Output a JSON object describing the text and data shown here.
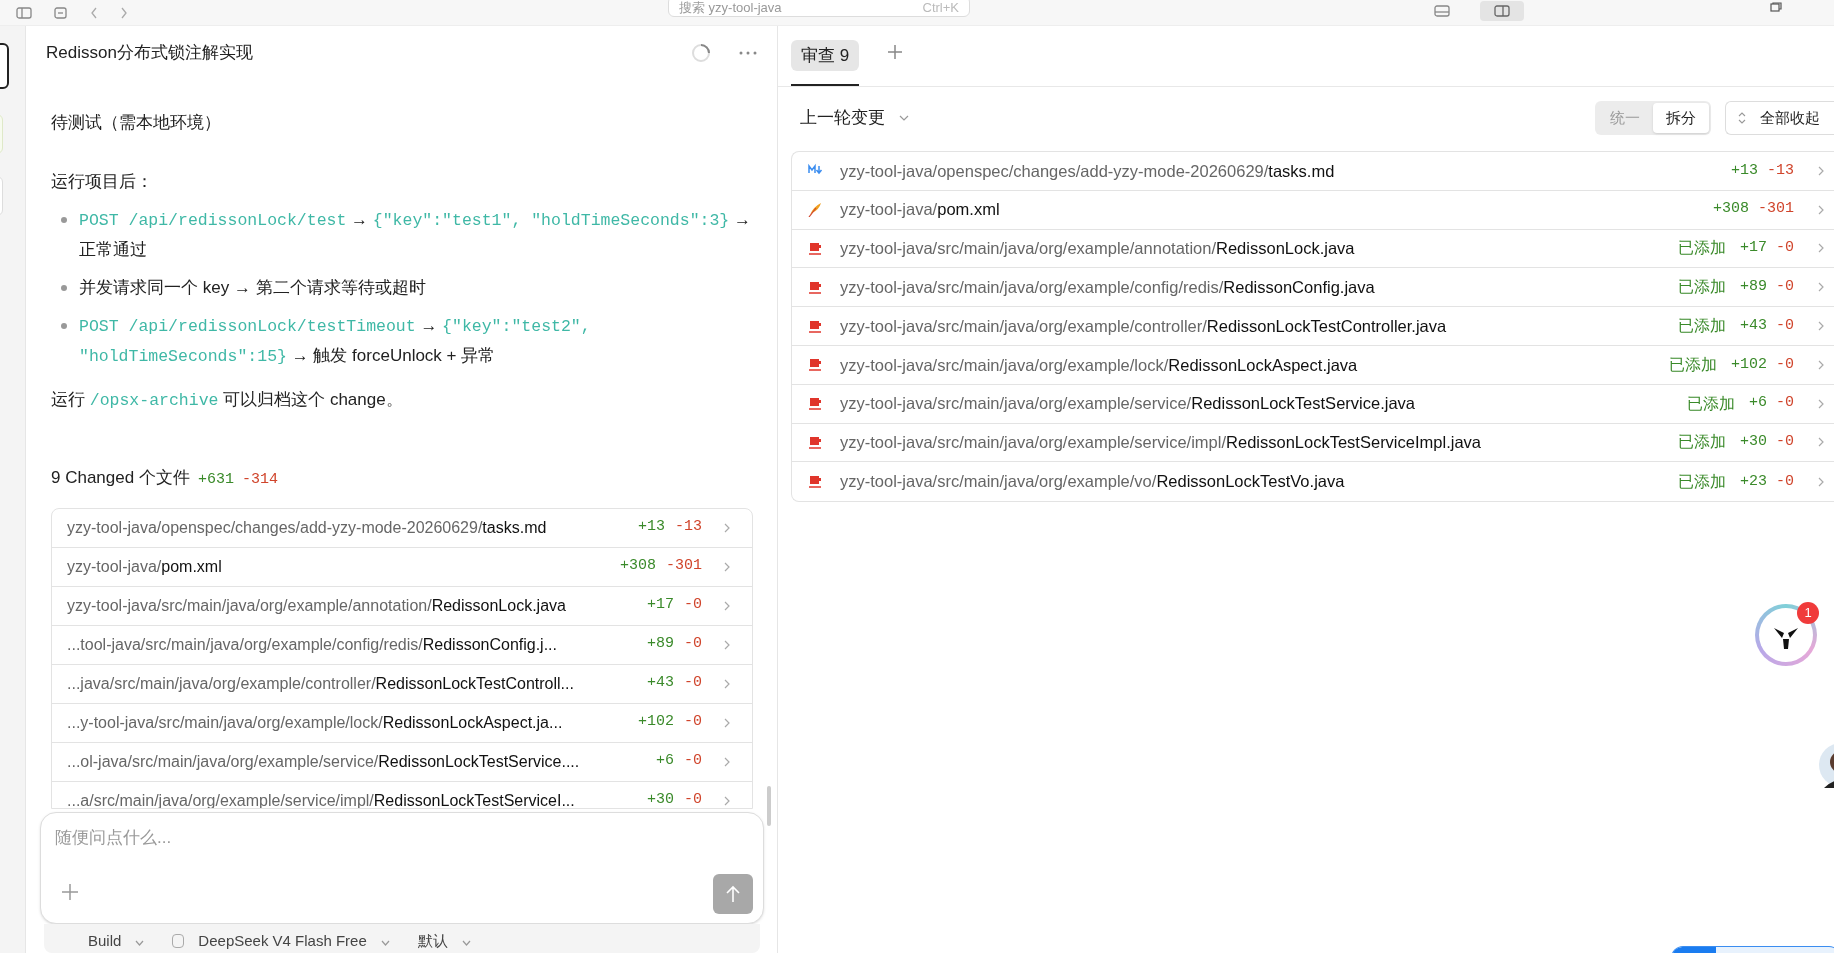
{
  "top_bar": {
    "search_placeholder": "搜索 yzy-tool-java",
    "shortcut": "Ctrl+K"
  },
  "chat": {
    "title": "Redisson分布式锁注解实现",
    "blocks": [
      {
        "kind": "paragraph",
        "segments": [
          {
            "kind": "text",
            "text": "待测试（需本地环境）"
          }
        ]
      },
      {
        "kind": "paragraph",
        "segments": [
          {
            "kind": "text",
            "text": "运行项目后："
          }
        ]
      },
      {
        "kind": "bullet",
        "segments": [
          {
            "kind": "code",
            "text": "POST /api/redissonLock/test"
          },
          {
            "kind": "text",
            "text": " → "
          },
          {
            "kind": "code",
            "text": "{\"key\":\"test1\", \"holdTimeSeconds\":3}"
          },
          {
            "kind": "text",
            "text": " → 正常通过"
          }
        ]
      },
      {
        "kind": "bullet",
        "segments": [
          {
            "kind": "text",
            "text": "并发请求同一个 key → 第二个请求等待或超时"
          }
        ]
      },
      {
        "kind": "bullet",
        "segments": [
          {
            "kind": "code",
            "text": "POST /api/redissonLock/testTimeout"
          },
          {
            "kind": "text",
            "text": " → "
          },
          {
            "kind": "code",
            "text": "{\"key\":\"test2\", \"holdTimeSeconds\":15}"
          },
          {
            "kind": "text",
            "text": " → 触发 forceUnlock + 异常"
          }
        ]
      },
      {
        "kind": "paragraph",
        "segments": [
          {
            "kind": "text",
            "text": "运行 "
          },
          {
            "kind": "code",
            "text": "/opsx-archive"
          },
          {
            "kind": "text",
            "text": " 可以归档这个 change。"
          }
        ]
      }
    ],
    "summary": {
      "label": "9 Changed 个文件",
      "added": "+631",
      "removed": "-314"
    },
    "files": [
      {
        "dir": "yzy-tool-java/openspec/changes/add-yzy-mode-20260629/",
        "name": "tasks.md",
        "added": "+13",
        "removed": "-13"
      },
      {
        "dir": "yzy-tool-java/",
        "name": "pom.xml",
        "added": "+308",
        "removed": "-301"
      },
      {
        "dir": "yzy-tool-java/src/main/java/org/example/annotation/",
        "name": "RedissonLock.java",
        "added": "+17",
        "removed": "-0"
      },
      {
        "dir": "...tool-java/src/main/java/org/example/config/redis/",
        "name": "RedissonConfig.j...",
        "added": "+89",
        "removed": "-0"
      },
      {
        "dir": "...java/src/main/java/org/example/controller/",
        "name": "RedissonLockTestControll...",
        "added": "+43",
        "removed": "-0"
      },
      {
        "dir": "...y-tool-java/src/main/java/org/example/lock/",
        "name": "RedissonLockAspect.ja...",
        "added": "+102",
        "removed": "-0"
      },
      {
        "dir": "...ol-java/src/main/java/org/example/service/",
        "name": "RedissonLockTestService....",
        "added": "+6",
        "removed": "-0"
      },
      {
        "dir": "...a/src/main/java/org/example/service/impl/",
        "name": "RedissonLockTestServiceI...",
        "added": "+30",
        "removed": "-0"
      }
    ],
    "composer": {
      "placeholder": "随便问点什么..."
    },
    "options": [
      "Build",
      "DeepSeek V4 Flash Free",
      "默认"
    ]
  },
  "review": {
    "tabs": [
      {
        "label": "审查 9",
        "selected": true
      }
    ],
    "filter": "上一轮变更",
    "view_modes": [
      {
        "label": "统一",
        "selected": false
      },
      {
        "label": "拆分",
        "selected": true
      }
    ],
    "collapse_button": "全部收起",
    "files": [
      {
        "kind": "markdown",
        "dir": "yzy-tool-java/openspec/changes/add-yzy-mode-20260629/",
        "name": "tasks.md",
        "added": "+13",
        "removed": "-13"
      },
      {
        "kind": "xml",
        "dir": "yzy-tool-java/",
        "name": "pom.xml",
        "added": "+308",
        "removed": "-301"
      },
      {
        "kind": "java",
        "dir": "yzy-tool-java/src/main/java/org/example/annotation/",
        "name": "RedissonLock.java",
        "status": "已添加",
        "added": "+17",
        "removed": "-0"
      },
      {
        "kind": "java",
        "dir": "yzy-tool-java/src/main/java/org/example/config/redis/",
        "name": "RedissonConfig.java",
        "status": "已添加",
        "added": "+89",
        "removed": "-0"
      },
      {
        "kind": "java",
        "dir": "yzy-tool-java/src/main/java/org/example/controller/",
        "name": "RedissonLockTestController.java",
        "status": "已添加",
        "added": "+43",
        "removed": "-0"
      },
      {
        "kind": "java",
        "dir": "yzy-tool-java/src/main/java/org/example/lock/",
        "name": "RedissonLockAspect.java",
        "status": "已添加",
        "added": "+102",
        "removed": "-0"
      },
      {
        "kind": "java",
        "dir": "yzy-tool-java/src/main/java/org/example/service/",
        "name": "RedissonLockTestService.java",
        "status": "已添加",
        "added": "+6",
        "removed": "-0"
      },
      {
        "kind": "java",
        "dir": "yzy-tool-java/src/main/java/org/example/service/impl/",
        "name": "RedissonLockTestServiceImpl.java",
        "status": "已添加",
        "added": "+30",
        "removed": "-0"
      },
      {
        "kind": "java",
        "dir": "yzy-tool-java/src/main/java/org/example/vo/",
        "name": "RedissonLockTestVo.java",
        "status": "已添加",
        "added": "+23",
        "removed": "-0"
      }
    ]
  },
  "assistant_badge": "1"
}
